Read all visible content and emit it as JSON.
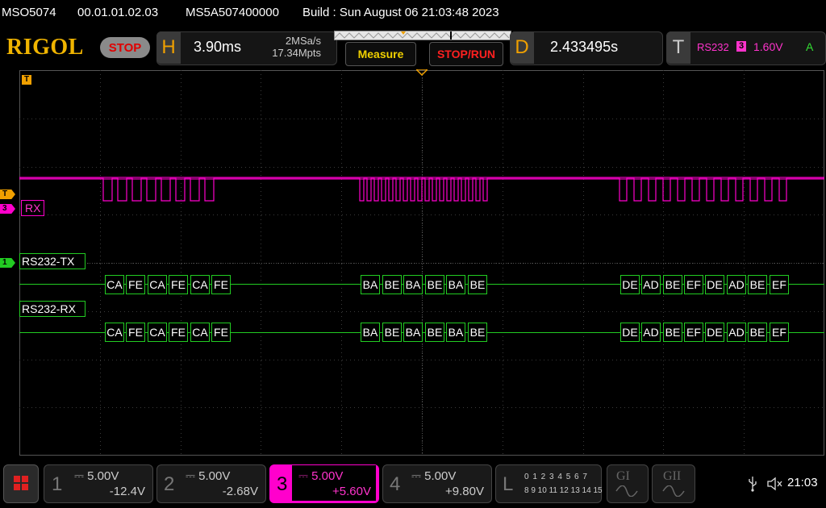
{
  "topbar": {
    "model": "MSO5074",
    "firmware": "00.01.01.02.03",
    "serial": "MS5A507400000",
    "build": "Build : Sun August 06 21:03:48 2023"
  },
  "logo": "RIGOL",
  "run_state": "STOP",
  "horizontal": {
    "letter": "H",
    "timebase": "3.90ms",
    "sample_rate": "2MSa/s",
    "memory_depth": "17.34Mpts"
  },
  "buttons": {
    "measure": "Measure",
    "stop_run": "STOP/RUN"
  },
  "delay": {
    "letter": "D",
    "value": "2.433495s"
  },
  "trigger": {
    "letter": "T",
    "type": "RS232",
    "source": "3",
    "level": "1.60V",
    "mode": "A"
  },
  "markers": {
    "trigger_top": "T",
    "trigger_left": "T",
    "ch3": "3",
    "ch1": "1"
  },
  "decode": {
    "rx_label": "RX",
    "tx_bus_label": "RS232-TX",
    "rx_bus_label": "RS232-RX",
    "bytes": [
      "CA",
      "FE",
      "CA",
      "FE",
      "CA",
      "FE",
      "BA",
      "BE",
      "BA",
      "BE",
      "BA",
      "BE",
      "DE",
      "AD",
      "BE",
      "EF",
      "DE",
      "AD",
      "BE",
      "EF"
    ]
  },
  "channels": [
    {
      "num": "1",
      "scale": "5.00V",
      "offset": "-12.4V"
    },
    {
      "num": "2",
      "scale": "5.00V",
      "offset": "-2.68V"
    },
    {
      "num": "3",
      "scale": "5.00V",
      "offset": "+5.60V"
    },
    {
      "num": "4",
      "scale": "5.00V",
      "offset": "+9.80V"
    }
  ],
  "logic": {
    "letter": "L",
    "row1": "0 1 2 3  4 5 6 7",
    "row2": "8 9 10 11 12 13 14 15"
  },
  "generators": [
    "GI",
    "GII"
  ],
  "status": {
    "time": "21:03"
  },
  "colors": {
    "ch1": "#22cc22",
    "ch3": "#ff00cc",
    "accent": "#f0a000",
    "grid": "#3a3a3a"
  }
}
